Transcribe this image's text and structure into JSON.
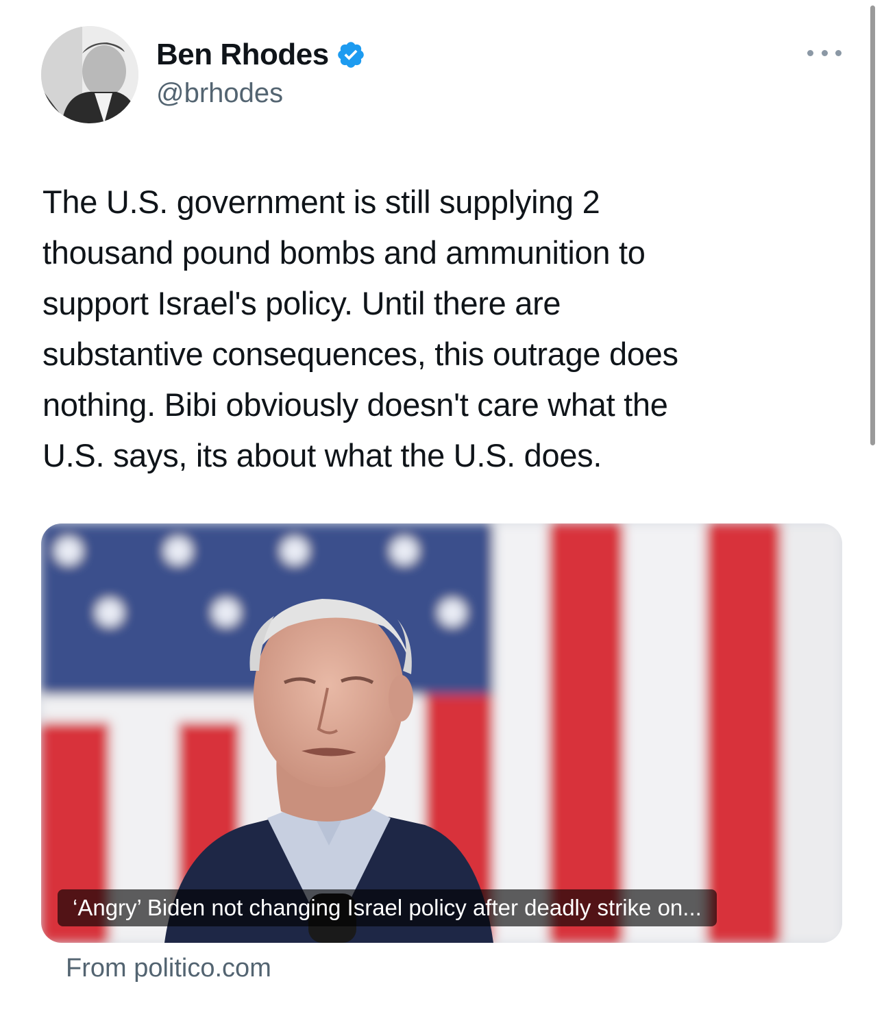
{
  "author": {
    "display_name": "Ben Rhodes",
    "handle": "@brhodes",
    "verified": true,
    "avatar_icon": "profile-photo"
  },
  "tweet": {
    "text": "The U.S. government is still supplying 2\nthousand pound bombs and ammunition to\nsupport Israel's policy. Until there are\nsubstantive consequences, this outrage does\nnothing. Bibi obviously doesn't care what the\nU.S. says, its about what the U.S. does."
  },
  "link_card": {
    "headline": "‘Angry’ Biden not changing Israel policy after deadly strike on...",
    "source": "From politico.com"
  },
  "colors": {
    "verified_blue": "#1d9bf0",
    "secondary_text": "#536471",
    "primary_text": "#0f1419",
    "flag_red": "#d8333a",
    "flag_blue": "#3b4f8c"
  }
}
